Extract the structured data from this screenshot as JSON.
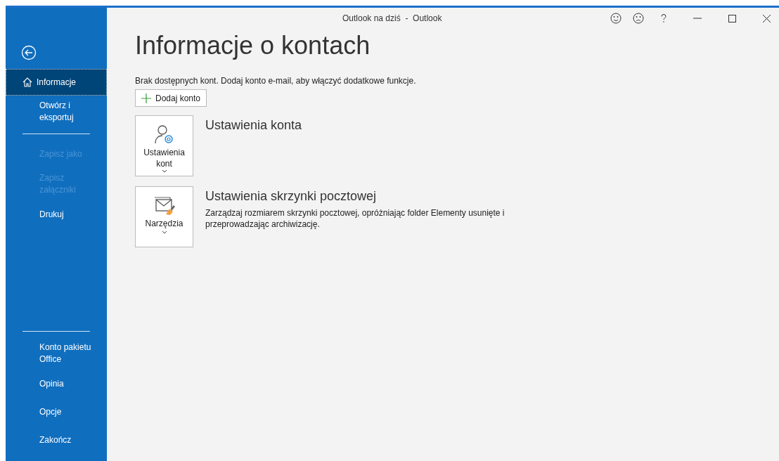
{
  "window": {
    "title": "Outlook na dziś  -  Outlook"
  },
  "sidebar": {
    "groups": [
      {
        "items": [
          {
            "label": "Informacje",
            "selected": true,
            "disabled": false,
            "kind": "home"
          },
          {
            "label": "Otwórz i eksportuj",
            "selected": false,
            "disabled": false
          }
        ]
      },
      {
        "items": [
          {
            "label": "Zapisz jako",
            "selected": false,
            "disabled": true
          },
          {
            "label": "Zapisz załączniki",
            "selected": false,
            "disabled": true
          },
          {
            "label": "Drukuj",
            "selected": false,
            "disabled": false
          }
        ]
      },
      {
        "items": [
          {
            "label": "Konto pakietu Office",
            "selected": false,
            "disabled": false
          },
          {
            "label": "Opinia",
            "selected": false,
            "disabled": false
          },
          {
            "label": "Opcje",
            "selected": false,
            "disabled": false
          },
          {
            "label": "Zakończ",
            "selected": false,
            "disabled": false
          }
        ]
      }
    ]
  },
  "page": {
    "title": "Informacje o kontach",
    "notice": "Brak dostępnych kont. Dodaj konto e-mail, aby włączyć dodatkowe funkcje.",
    "add_button": "Dodaj konto",
    "sections": [
      {
        "kind": "account",
        "button": "Ustawienia kont",
        "title": "Ustawienia konta"
      },
      {
        "kind": "tools",
        "button": "Narzędzia",
        "title": "Ustawienia skrzynki pocztowej",
        "description": "Zarządzaj rozmiarem skrzynki pocztowej, opróżniając folder Elementy usunięte i przeprowadzając archiwizację."
      }
    ]
  }
}
